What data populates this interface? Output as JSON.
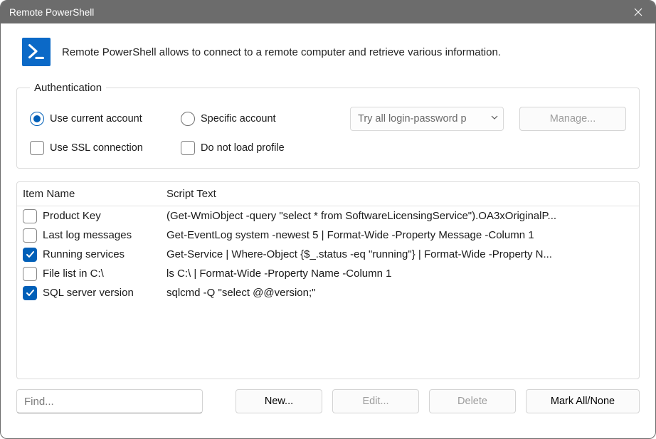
{
  "window": {
    "title": "Remote PowerShell"
  },
  "header": {
    "description": "Remote PowerShell allows to connect to a remote computer and retrieve various information."
  },
  "auth": {
    "legend": "Authentication",
    "use_current": "Use current account",
    "specific": "Specific account",
    "combo_value": "Try all login-password p",
    "manage": "Manage...",
    "use_ssl": "Use SSL connection",
    "no_profile": "Do not load profile"
  },
  "list": {
    "col_name": "Item Name",
    "col_script": "Script Text",
    "rows": [
      {
        "checked": false,
        "name": "Product Key",
        "script": "(Get-WmiObject -query \"select * from SoftwareLicensingService\").OA3xOriginalP..."
      },
      {
        "checked": false,
        "name": "Last log messages",
        "script": "Get-EventLog system -newest 5 | Format-Wide -Property Message -Column 1"
      },
      {
        "checked": true,
        "name": "Running services",
        "script": "Get-Service | Where-Object {$_.status -eq \"running\"} | Format-Wide -Property N..."
      },
      {
        "checked": false,
        "name": "File list in C:\\",
        "script": "ls C:\\ | Format-Wide -Property Name -Column 1"
      },
      {
        "checked": true,
        "name": "SQL server version",
        "script": "sqlcmd -Q \"select @@version;\""
      }
    ]
  },
  "bottom": {
    "find_placeholder": "Find...",
    "new": "New...",
    "edit": "Edit...",
    "delete": "Delete",
    "mark": "Mark All/None"
  }
}
